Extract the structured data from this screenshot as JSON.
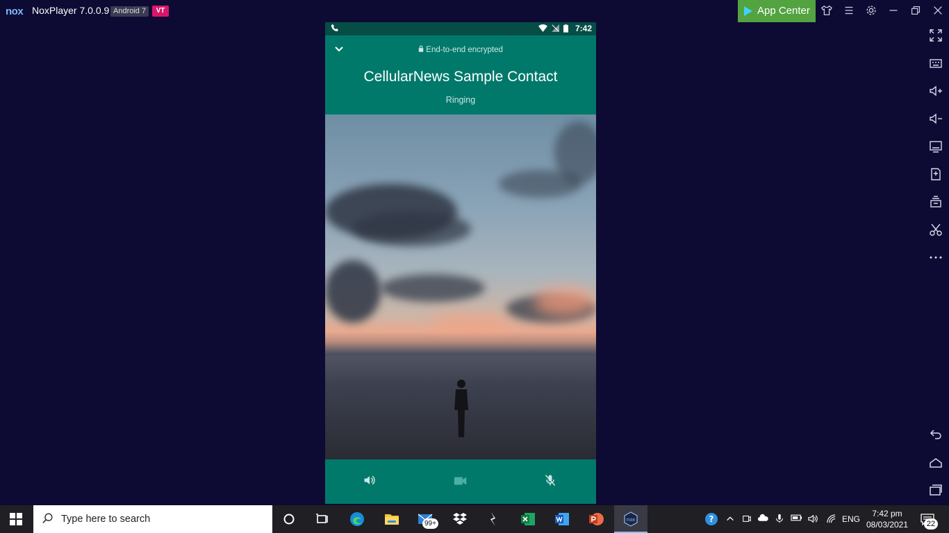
{
  "titlebar": {
    "logo": "nox",
    "app_title": "NoxPlayer 7.0.0.9",
    "android_badge": "Android 7",
    "vt_badge": "VT",
    "app_center_label": "App Center"
  },
  "phone": {
    "status_time": "7:42",
    "encryption_text": "End-to-end encrypted",
    "contact_name": "CellularNews Sample Contact",
    "call_status": "Ringing",
    "colors": {
      "header": "#00796b",
      "status_bar": "#054d45",
      "end_call": "#ec1a4f"
    }
  },
  "sidebar_icons": [
    "fullscreen-icon",
    "keyboard-icon",
    "volume-up-icon",
    "volume-down-icon",
    "screen-icon",
    "add-apk-icon",
    "multi-instance-icon",
    "scissors-icon",
    "more-icon",
    "back-icon",
    "home-icon",
    "recents-icon"
  ],
  "taskbar": {
    "search_placeholder": "Type here to search",
    "mail_badge": "99+",
    "language": "ENG",
    "time": "7:42 pm",
    "date": "08/03/2021",
    "notification_count": "22"
  }
}
